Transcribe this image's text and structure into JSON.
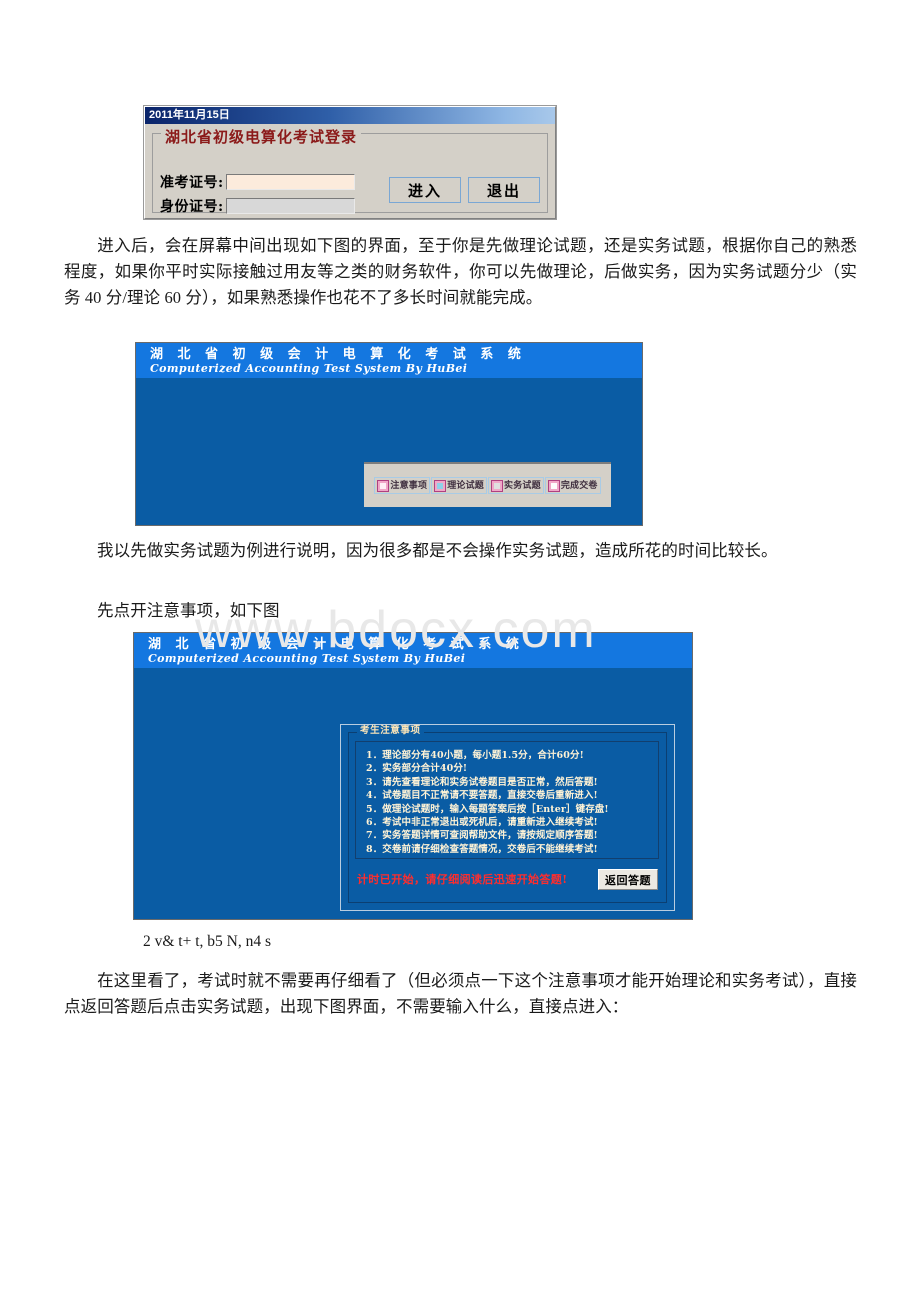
{
  "watermark": "www.bdocx.com",
  "login_dialog": {
    "title_date": "2011年11月15日",
    "group_legend": "湖北省初级电算化考试登录",
    "fields": [
      {
        "label": "准考证号:",
        "value": ""
      },
      {
        "label": "身份证号:",
        "value": ""
      }
    ],
    "enter_button": "进入",
    "exit_button": "退出"
  },
  "paragraphs": {
    "p1": "进入后，会在屏幕中间出现如下图的界面，至于你是先做理论试题，还是实务试题，根据你自己的熟悉程度，如果你平时实际接触过用友等之类的财务软件，你可以先做理论，后做实务，因为实务试题分少（实务 40 分/理论 60 分），如果熟悉操作也花不了多长时间就能完成。",
    "p2": "我以先做实务试题为例进行说明，因为很多都是不会操作实务试题，造成所花的时间比较长。",
    "p3": "先点开注意事项，如下图",
    "p4": "2 v& t+ t, b5 N, n4 s",
    "p5": "在这里看了，考试时就不需要再仔细看了（但必须点一下这个注意事项才能开始理论和实务考试），直接点返回答题后点击实务试题，出现下图界面，不需要输入什么，直接点进入："
  },
  "exam_window": {
    "title_cn": "湖 北 省 初 级 会 计 电 算 化 考 试 系 统",
    "title_en": "Computerized  Accounting  Test  System By HuBei",
    "toolbar": [
      {
        "label": "注意事项",
        "icon": "notice-icon"
      },
      {
        "label": "理论试题",
        "icon": "theory-icon"
      },
      {
        "label": "实务试题",
        "icon": "practice-icon"
      },
      {
        "label": "完成交卷",
        "icon": "submit-icon"
      }
    ]
  },
  "notice_dialog": {
    "legend": "考生注意事项",
    "items": [
      "1．理论部分有40小题，每小题1.5分，合计60分!",
      "2．实务部分合计40分!",
      "3．请先查看理论和实务试卷题目是否正常，然后答题!",
      "4．试卷题目不正常请不要答题，直接交卷后重新进入!",
      "5．做理论试题时，输入每题答案后按［Enter］键存盘!",
      "6．考试中非正常退出或死机后，请重新进入继续考试!",
      "7．实务答题详情可查阅帮助文件，请按规定顺序答题!",
      "8．交卷前请仔细检查答题情况，交卷后不能继续考试!"
    ],
    "warning": "计时已开始，请仔细阅读后迅速开始答题!",
    "back_button": "返回答题"
  },
  "colors": {
    "window_body": "#0a5ca4",
    "window_header": "#1477e0",
    "dialog_face": "#d4d0c8",
    "legend_red": "#8b1a1a",
    "warning_red": "#ff2d2d"
  }
}
